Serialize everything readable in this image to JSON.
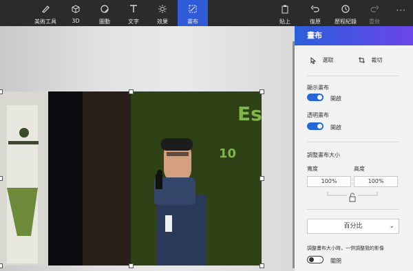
{
  "toolbar": {
    "tools": [
      {
        "label": "美術工具",
        "icon": "brush-icon"
      },
      {
        "label": "3D",
        "icon": "cube-icon"
      },
      {
        "label": "圖動",
        "icon": "sticker-icon"
      },
      {
        "label": "文字",
        "icon": "text-icon"
      },
      {
        "label": "效果",
        "icon": "effects-icon"
      },
      {
        "label": "畫布",
        "icon": "canvas-icon",
        "active": true
      }
    ],
    "right": [
      {
        "label": "貼上",
        "icon": "paste-icon"
      },
      {
        "label": "復原",
        "icon": "undo-icon"
      },
      {
        "label": "歷程紀錄",
        "icon": "history-icon"
      },
      {
        "label": "重做",
        "icon": "redo-icon",
        "disabled": true
      }
    ],
    "more": "···"
  },
  "panel": {
    "title": "畫布",
    "select_label": "選取",
    "crop_label": "裁切",
    "show_canvas": "顯示畫布",
    "show_canvas_value": "開啟",
    "transparent_canvas": "透明畫布",
    "transparent_value": "開啟",
    "resize_title": "調整畫布大小",
    "width_label": "寬度",
    "height_label": "高度",
    "width_value": "100%",
    "height_value": "100%",
    "unit_select": "百分比",
    "resize_image_label": "調整畫布大小時，一併調整我的影像",
    "resize_image_value": "關閉"
  },
  "colors": {
    "accent": "#2f5bd9"
  }
}
